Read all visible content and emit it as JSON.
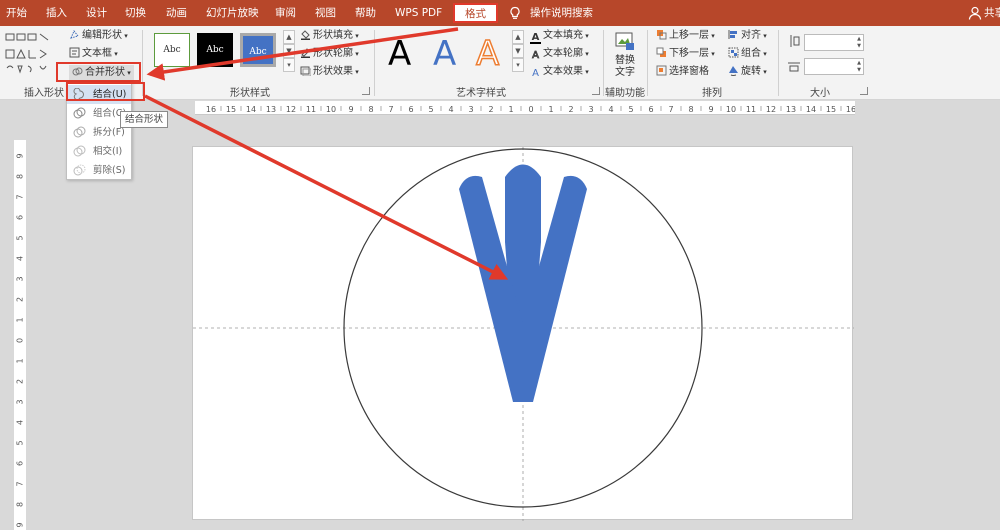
{
  "tabs": [
    {
      "label": "开始"
    },
    {
      "label": "插入"
    },
    {
      "label": "设计"
    },
    {
      "label": "切换"
    },
    {
      "label": "动画"
    },
    {
      "label": "幻灯片放映"
    },
    {
      "label": "审阅"
    },
    {
      "label": "视图"
    },
    {
      "label": "帮助"
    },
    {
      "label": "WPS PDF"
    },
    {
      "label": "格式"
    }
  ],
  "search": {
    "label": "操作说明搜索"
  },
  "account": {
    "share_label": "共享"
  },
  "ribbon": {
    "insert_shapes": {
      "edit_shape": "编辑形状",
      "text_box": "文本框",
      "merge_shapes": "合并形状",
      "group_label": "插入形状"
    },
    "shape_styles": {
      "style_samples": [
        "Abc",
        "Abc",
        "Abc"
      ],
      "fill": "形状填充",
      "outline": "形状轮廓",
      "effects": "形状效果",
      "group_label": "形状样式"
    },
    "wordart": {
      "samples": [
        "A",
        "A",
        "A"
      ],
      "text_fill": "文本填充",
      "text_outline": "文本轮廓",
      "text_effects": "文本效果",
      "group_label": "艺术字样式"
    },
    "accessibility": {
      "alt_text": "替换文字",
      "group_label": "辅助功能"
    },
    "arrange": {
      "bring_forward": "上移一层",
      "send_backward": "下移一层",
      "selection_pane": "选择窗格",
      "align": "对齐",
      "group": "组合",
      "rotate": "旋转",
      "group_label": "排列"
    },
    "size": {
      "group_label": "大小"
    }
  },
  "merge_menu": {
    "items": [
      {
        "label": "结合(U)"
      },
      {
        "label": "组合(C)"
      },
      {
        "label": "拆分(F)"
      },
      {
        "label": "相交(I)"
      },
      {
        "label": "剪除(S)"
      }
    ],
    "tooltip": "结合形状"
  },
  "ruler": {
    "h_labels": [
      "16",
      "15",
      "14",
      "13",
      "12",
      "11",
      "10",
      "9",
      "8",
      "7",
      "6",
      "5",
      "4",
      "3",
      "2",
      "1",
      "0",
      "1",
      "2",
      "3",
      "4",
      "5",
      "6",
      "7",
      "8",
      "9",
      "10",
      "11",
      "12",
      "13",
      "14",
      "15",
      "16"
    ],
    "v_labels": [
      "9",
      "8",
      "7",
      "6",
      "5",
      "4",
      "3",
      "2",
      "1",
      "0",
      "1",
      "2",
      "3",
      "4",
      "5",
      "6",
      "7",
      "8",
      "9"
    ]
  },
  "colors": {
    "accent": "#b7472a",
    "highlight": "#e0392b",
    "shape_fill": "#4472c4",
    "menu_active": "#d5e1f2"
  }
}
